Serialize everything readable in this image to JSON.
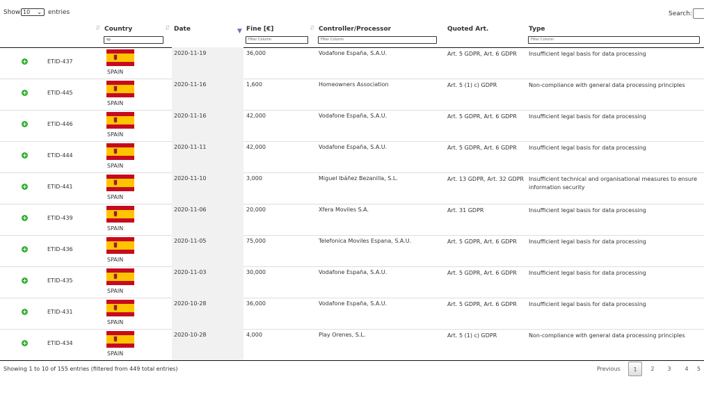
{
  "controls": {
    "show_label": "Show",
    "length_value": "10",
    "entries_label": "entries",
    "search_label": "Search:"
  },
  "columns": [
    {
      "label": "",
      "sortable": false
    },
    {
      "label": "",
      "sortable": false
    },
    {
      "label": "Country",
      "sortable": true,
      "filter": "sp"
    },
    {
      "label": "Date",
      "sortable": true
    },
    {
      "label": "Fine [€]",
      "sortable": true,
      "sorted": "desc",
      "filter_placeholder": "Filter Column"
    },
    {
      "label": "Controller/Processor",
      "sortable": true,
      "filter_placeholder": "Filter Column"
    },
    {
      "label": "Quoted Art.",
      "sortable": false
    },
    {
      "label": "Type",
      "sortable": false,
      "filter_placeholder": "Filter Column"
    }
  ],
  "rows": [
    {
      "id": "ETID-437",
      "country": "SPAIN",
      "date": "2020-11-19",
      "fine": "36,000",
      "controller": "Vodafone España, S.A.U.",
      "quoted": "Art. 5 GDPR, Art. 6 GDPR",
      "type": "Insufficient legal basis for data processing"
    },
    {
      "id": "ETID-445",
      "country": "SPAIN",
      "date": "2020-11-16",
      "fine": "1,600",
      "controller": "Homeowners Association",
      "quoted": "Art. 5 (1) c) GDPR",
      "type": "Non-compliance with general data processing principles"
    },
    {
      "id": "ETID-446",
      "country": "SPAIN",
      "date": "2020-11-16",
      "fine": "42,000",
      "controller": "Vodafone España, S.A.U.",
      "quoted": "Art. 5 GDPR, Art. 6 GDPR",
      "type": "Insufficient legal basis for data processing"
    },
    {
      "id": "ETID-444",
      "country": "SPAIN",
      "date": "2020-11-11",
      "fine": "42,000",
      "controller": "Vodafone España, S.A.U.",
      "quoted": "Art. 5 GDPR, Art. 6 GDPR",
      "type": "Insufficient legal basis for data processing"
    },
    {
      "id": "ETID-441",
      "country": "SPAIN",
      "date": "2020-11-10",
      "fine": "3,000",
      "controller": "Miguel Ibáñez Bezanilla, S.L.",
      "quoted": "Art. 13 GDPR, Art. 32 GDPR",
      "type": "Insufficient technical and organisational measures to ensure information security"
    },
    {
      "id": "ETID-439",
      "country": "SPAIN",
      "date": "2020-11-06",
      "fine": "20,000",
      "controller": "Xfera Moviles S.A.",
      "quoted": "Art. 31 GDPR",
      "type": "Insufficient legal basis for data processing"
    },
    {
      "id": "ETID-436",
      "country": "SPAIN",
      "date": "2020-11-05",
      "fine": "75,000",
      "controller": "Telefonica Moviles Espana, S.A.U.",
      "quoted": "Art. 5 GDPR, Art. 6 GDPR",
      "type": "Insufficient legal basis for data processing"
    },
    {
      "id": "ETID-435",
      "country": "SPAIN",
      "date": "2020-11-03",
      "fine": "30,000",
      "controller": "Vodafone España, S.A.U.",
      "quoted": "Art. 5 GDPR, Art. 6 GDPR",
      "type": "Insufficient legal basis for data processing"
    },
    {
      "id": "ETID-431",
      "country": "SPAIN",
      "date": "2020-10-28",
      "fine": "36,000",
      "controller": "Vodafone España, S.A.U.",
      "quoted": "Art. 5 GDPR, Art. 6 GDPR",
      "type": "Insufficient legal basis for data processing"
    },
    {
      "id": "ETID-434",
      "country": "SPAIN",
      "date": "2020-10-28",
      "fine": "4,000",
      "controller": "Play Orenes, S.L.",
      "quoted": "Art. 5 (1) c) GDPR",
      "type": "Non-compliance with general data processing principles"
    }
  ],
  "info": "Showing 1 to 10 of 155 entries (filtered from 449 total entries)",
  "pagination": {
    "previous": "Previous",
    "pages": [
      "1",
      "2",
      "3",
      "4",
      "5"
    ],
    "current": "1"
  },
  "colors": {
    "expand_green": "#31b131",
    "flag_red": "#c60b1e",
    "flag_yellow": "#ffc400"
  }
}
